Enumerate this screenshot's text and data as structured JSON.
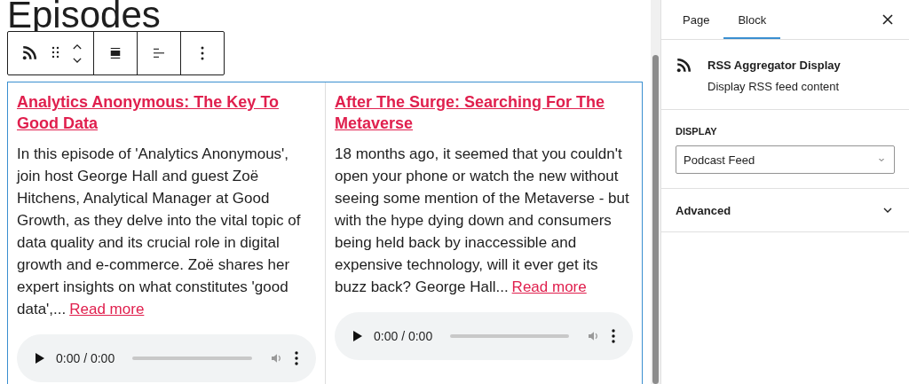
{
  "heading": "Episodes",
  "toolbar": {
    "groups": [
      [
        {
          "kind": "rss"
        },
        {
          "kind": "drag"
        },
        {
          "kind": "move"
        }
      ],
      [
        {
          "kind": "align-wide"
        }
      ],
      [
        {
          "kind": "justify"
        }
      ],
      [
        {
          "kind": "more"
        }
      ]
    ]
  },
  "episodes": [
    {
      "title": "Analytics Anonymous: The Key To Good Data",
      "excerpt": "In this episode of 'Analytics Anonymous', join host George Hall and guest Zoë Hitchens, Analytical Manager at Good Growth, as they delve into the vital topic of data quality and its crucial role in digital growth and e-commerce. Zoë shares her expert insights on what constitutes 'good data',...",
      "link": "Read more",
      "time": "0:00 / 0:00"
    },
    {
      "title": "After The Surge: Searching For The Metaverse",
      "excerpt": "18 months ago, it seemed that you couldn't open your phone or watch the new without seeing some mention of the Metaverse - but with the hype dying down and consumers being held back by inaccessible and expensive technology, will it ever get its buzz back? George Hall...",
      "link": "Read more",
      "time": "0:00 / 0:00"
    }
  ],
  "sidebar": {
    "tabs": [
      {
        "label": "Page",
        "selected": false
      },
      {
        "label": "Block",
        "selected": true
      }
    ],
    "block": {
      "name": "RSS Aggregator Display",
      "description": "Display RSS feed content"
    },
    "panels": [
      {
        "kind": "select",
        "label": "DISPLAY",
        "value": "Podcast Feed"
      },
      {
        "kind": "collapsible",
        "label": "Advanced",
        "expanded": false
      }
    ]
  }
}
